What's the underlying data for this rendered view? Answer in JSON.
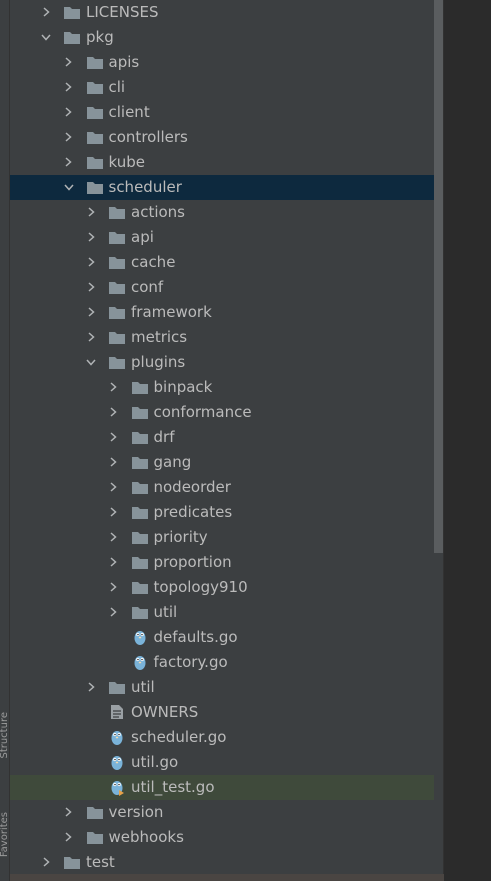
{
  "left_toolbar": {
    "structure_label": "Structure",
    "favorites_label": "Favorites"
  },
  "colors": {
    "background": "#3c3f41",
    "selected_row": "#0d293e",
    "hovered_row": "#3f4a3b",
    "folder": "#87939a",
    "text": "#bbbbbb",
    "gopher": "#7ab3d9"
  },
  "tree": [
    {
      "label": "LICENSES",
      "depth": 0,
      "kind": "folder",
      "expanded": false,
      "state": ""
    },
    {
      "label": "pkg",
      "depth": 0,
      "kind": "folder",
      "expanded": true,
      "state": ""
    },
    {
      "label": "apis",
      "depth": 1,
      "kind": "folder",
      "expanded": false,
      "state": ""
    },
    {
      "label": "cli",
      "depth": 1,
      "kind": "folder",
      "expanded": false,
      "state": ""
    },
    {
      "label": "client",
      "depth": 1,
      "kind": "folder",
      "expanded": false,
      "state": ""
    },
    {
      "label": "controllers",
      "depth": 1,
      "kind": "folder",
      "expanded": false,
      "state": ""
    },
    {
      "label": "kube",
      "depth": 1,
      "kind": "folder",
      "expanded": false,
      "state": ""
    },
    {
      "label": "scheduler",
      "depth": 1,
      "kind": "folder",
      "expanded": true,
      "state": "selected"
    },
    {
      "label": "actions",
      "depth": 2,
      "kind": "folder",
      "expanded": false,
      "state": ""
    },
    {
      "label": "api",
      "depth": 2,
      "kind": "folder",
      "expanded": false,
      "state": ""
    },
    {
      "label": "cache",
      "depth": 2,
      "kind": "folder",
      "expanded": false,
      "state": ""
    },
    {
      "label": "conf",
      "depth": 2,
      "kind": "folder",
      "expanded": false,
      "state": ""
    },
    {
      "label": "framework",
      "depth": 2,
      "kind": "folder",
      "expanded": false,
      "state": ""
    },
    {
      "label": "metrics",
      "depth": 2,
      "kind": "folder",
      "expanded": false,
      "state": ""
    },
    {
      "label": "plugins",
      "depth": 2,
      "kind": "folder",
      "expanded": true,
      "state": ""
    },
    {
      "label": "binpack",
      "depth": 3,
      "kind": "folder",
      "expanded": false,
      "state": ""
    },
    {
      "label": "conformance",
      "depth": 3,
      "kind": "folder",
      "expanded": false,
      "state": ""
    },
    {
      "label": "drf",
      "depth": 3,
      "kind": "folder",
      "expanded": false,
      "state": ""
    },
    {
      "label": "gang",
      "depth": 3,
      "kind": "folder",
      "expanded": false,
      "state": ""
    },
    {
      "label": "nodeorder",
      "depth": 3,
      "kind": "folder",
      "expanded": false,
      "state": ""
    },
    {
      "label": "predicates",
      "depth": 3,
      "kind": "folder",
      "expanded": false,
      "state": ""
    },
    {
      "label": "priority",
      "depth": 3,
      "kind": "folder",
      "expanded": false,
      "state": ""
    },
    {
      "label": "proportion",
      "depth": 3,
      "kind": "folder",
      "expanded": false,
      "state": ""
    },
    {
      "label": "topology910",
      "depth": 3,
      "kind": "folder",
      "expanded": false,
      "state": ""
    },
    {
      "label": "util",
      "depth": 3,
      "kind": "folder",
      "expanded": false,
      "state": ""
    },
    {
      "label": "defaults.go",
      "depth": 3,
      "kind": "gofile",
      "expanded": false,
      "state": ""
    },
    {
      "label": "factory.go",
      "depth": 3,
      "kind": "gofile",
      "expanded": false,
      "state": ""
    },
    {
      "label": "util",
      "depth": 2,
      "kind": "folder",
      "expanded": false,
      "state": ""
    },
    {
      "label": "OWNERS",
      "depth": 2,
      "kind": "textfile",
      "expanded": false,
      "state": ""
    },
    {
      "label": "scheduler.go",
      "depth": 2,
      "kind": "gofile",
      "expanded": false,
      "state": ""
    },
    {
      "label": "util.go",
      "depth": 2,
      "kind": "gofile",
      "expanded": false,
      "state": ""
    },
    {
      "label": "util_test.go",
      "depth": 2,
      "kind": "gotest",
      "expanded": false,
      "state": "hovered"
    },
    {
      "label": "version",
      "depth": 1,
      "kind": "folder",
      "expanded": false,
      "state": ""
    },
    {
      "label": "webhooks",
      "depth": 1,
      "kind": "folder",
      "expanded": false,
      "state": ""
    },
    {
      "label": "test",
      "depth": 0,
      "kind": "folder",
      "expanded": false,
      "state": ""
    }
  ]
}
